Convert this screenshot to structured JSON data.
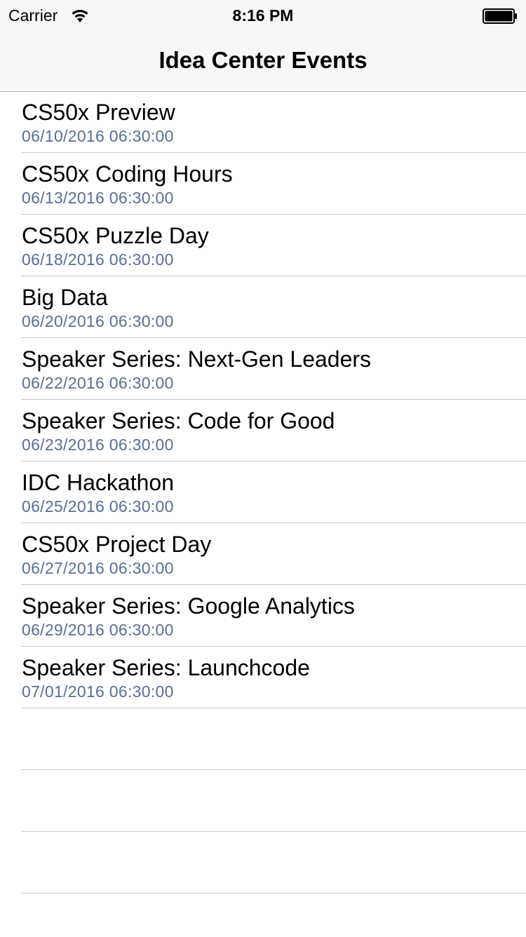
{
  "status_bar": {
    "carrier": "Carrier",
    "time": "8:16 PM"
  },
  "nav_bar": {
    "title": "Idea Center Events"
  },
  "events": [
    {
      "title": "CS50x Preview",
      "date": "06/10/2016 06:30:00"
    },
    {
      "title": "CS50x Coding Hours",
      "date": "06/13/2016 06:30:00"
    },
    {
      "title": "CS50x Puzzle Day",
      "date": "06/18/2016 06:30:00"
    },
    {
      "title": "Big Data",
      "date": "06/20/2016 06:30:00"
    },
    {
      "title": "Speaker Series: Next-Gen Leaders",
      "date": "06/22/2016 06:30:00"
    },
    {
      "title": "Speaker Series: Code for Good",
      "date": "06/23/2016 06:30:00"
    },
    {
      "title": "IDC Hackathon",
      "date": "06/25/2016 06:30:00"
    },
    {
      "title": "CS50x Project Day",
      "date": "06/27/2016 06:30:00"
    },
    {
      "title": "Speaker Series: Google Analytics",
      "date": "06/29/2016 06:30:00"
    },
    {
      "title": "Speaker Series: Launchcode",
      "date": "07/01/2016 06:30:00"
    }
  ],
  "colors": {
    "subtitle": "#5a6e8f",
    "separator": "#c8c7cc",
    "bar_background": "#f7f7f7"
  }
}
